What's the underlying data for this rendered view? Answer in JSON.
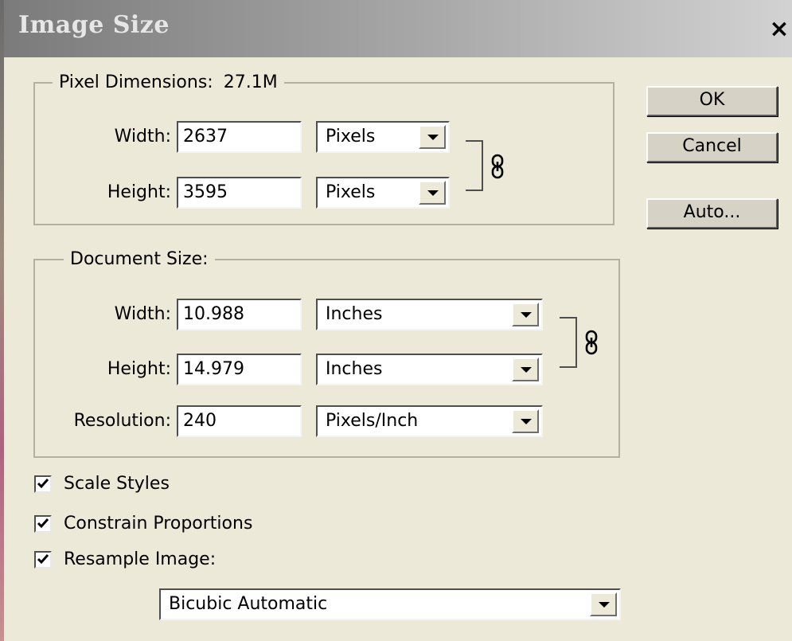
{
  "window": {
    "title": "Image Size",
    "close_label": "×"
  },
  "pixel_dimensions": {
    "legend": "Pixel Dimensions:",
    "size": "27.1M",
    "width_label": "Width:",
    "width_value": "2637",
    "width_unit": "Pixels",
    "height_label": "Height:",
    "height_value": "3595",
    "height_unit": "Pixels"
  },
  "document_size": {
    "legend": "Document Size:",
    "width_label": "Width:",
    "width_value": "10.988",
    "width_unit": "Inches",
    "height_label": "Height:",
    "height_value": "14.979",
    "height_unit": "Inches",
    "resolution_label": "Resolution:",
    "resolution_value": "240",
    "resolution_unit": "Pixels/Inch"
  },
  "buttons": {
    "ok": "OK",
    "cancel": "Cancel",
    "auto": "Auto..."
  },
  "options": {
    "scale_styles": {
      "label": "Scale Styles",
      "checked": true
    },
    "constrain_proportions": {
      "label": "Constrain Proportions",
      "checked": true
    },
    "resample_image": {
      "label": "Resample Image:",
      "checked": true
    },
    "resample_method": "Bicubic Automatic"
  },
  "icons": {
    "link": "chain-link-icon",
    "dropdown": "chevron-down-icon",
    "check": "checkmark-icon"
  }
}
